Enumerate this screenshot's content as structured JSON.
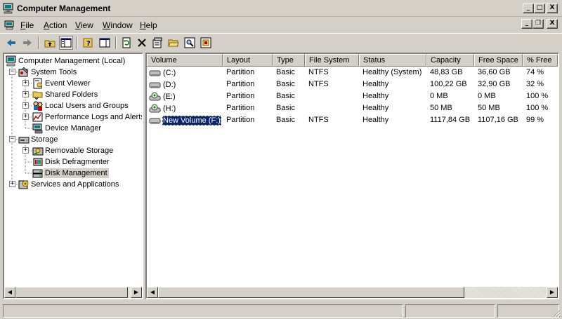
{
  "window": {
    "title": "Computer Management",
    "controls": {
      "minimize": "_",
      "maximize": "□",
      "close": "X"
    },
    "mdi_controls": {
      "minimize": "_",
      "restore": "❐",
      "close": "X"
    }
  },
  "menu": {
    "items": [
      {
        "label": "File",
        "accel": "F",
        "rest": "ile"
      },
      {
        "label": "Action",
        "accel": "A",
        "rest": "ction"
      },
      {
        "label": "View",
        "accel": "V",
        "rest": "iew"
      },
      {
        "label": "Window",
        "accel": "W",
        "rest": "indow"
      },
      {
        "label": "Help",
        "accel": "H",
        "rest": "elp"
      }
    ]
  },
  "toolbar": {
    "buttons": [
      "back-icon",
      "forward-icon",
      "up-one-level-icon",
      "show-hide-tree-icon",
      "help-icon",
      "show-hide-action-pane-icon",
      "refresh-icon",
      "delete-icon",
      "properties-icon",
      "open-folder-icon",
      "search-icon",
      "export-icon"
    ]
  },
  "tree": {
    "root": "Computer Management (Local)",
    "system_tools": "System Tools",
    "event_viewer": "Event Viewer",
    "shared_folders": "Shared Folders",
    "local_users": "Local Users and Groups",
    "perf_logs": "Performance Logs and Alerts",
    "device_manager": "Device Manager",
    "storage": "Storage",
    "removable_storage": "Removable Storage",
    "disk_defrag": "Disk Defragmenter",
    "disk_management": "Disk Management",
    "services_apps": "Services and Applications",
    "selected": "Disk Management"
  },
  "list": {
    "columns": [
      "Volume",
      "Layout",
      "Type",
      "File System",
      "Status",
      "Capacity",
      "Free Space",
      "% Free"
    ],
    "rows": [
      {
        "volume": "(C:)",
        "layout": "Partition",
        "type": "Basic",
        "fs": "NTFS",
        "status": "Healthy (System)",
        "capacity": "48,83 GB",
        "free": "36,60 GB",
        "pct": "74 %",
        "icon": "hard-disk-icon"
      },
      {
        "volume": "(D:)",
        "layout": "Partition",
        "type": "Basic",
        "fs": "NTFS",
        "status": "Healthy",
        "capacity": "100,22 GB",
        "free": "32,90 GB",
        "pct": "32 %",
        "icon": "hard-disk-icon"
      },
      {
        "volume": "(E:)",
        "layout": "Partition",
        "type": "Basic",
        "fs": "",
        "status": "Healthy",
        "capacity": "0 MB",
        "free": "0 MB",
        "pct": "100 %",
        "icon": "cd-drive-icon"
      },
      {
        "volume": "(H:)",
        "layout": "Partition",
        "type": "Basic",
        "fs": "",
        "status": "Healthy",
        "capacity": "50 MB",
        "free": "50 MB",
        "pct": "100 %",
        "icon": "cd-drive-icon"
      },
      {
        "volume": "New Volume (F:)",
        "layout": "Partition",
        "type": "Basic",
        "fs": "NTFS",
        "status": "Healthy",
        "capacity": "1117,84 GB",
        "free": "1107,16 GB",
        "pct": "99 %",
        "icon": "hard-disk-icon",
        "selected": true
      }
    ]
  },
  "colors": {
    "chrome": "#d4d0c8",
    "selection": "#0a246a",
    "pane": "#ffffff"
  }
}
